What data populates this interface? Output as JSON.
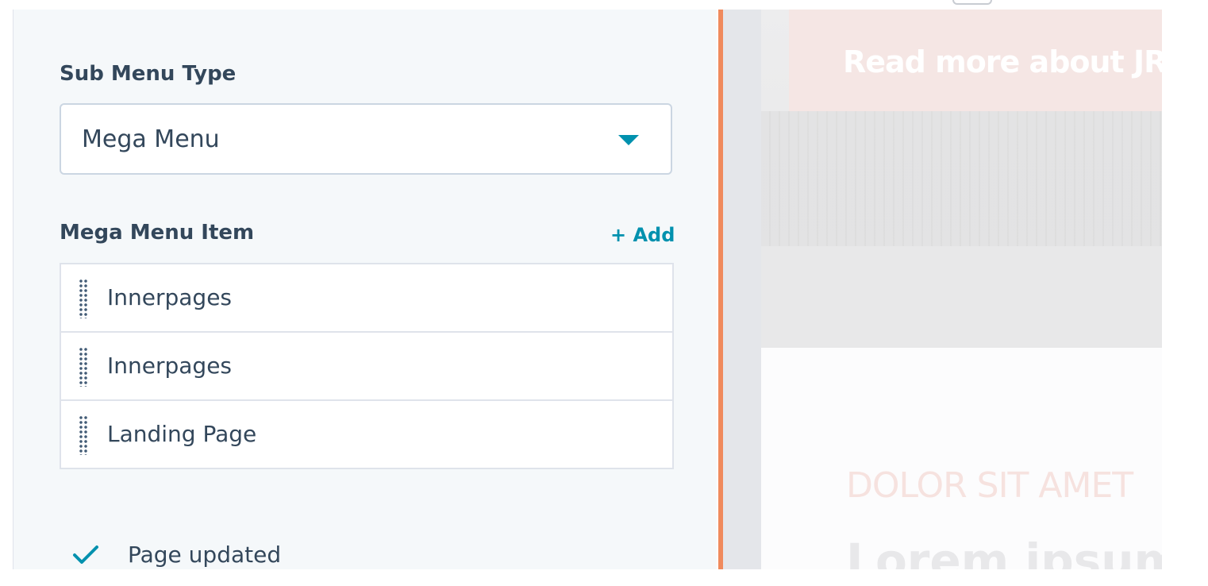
{
  "editor": {
    "sub_menu_type": {
      "label": "Sub Menu Type",
      "value": "Mega Menu"
    },
    "mega_menu_items": {
      "label": "Mega Menu Item",
      "add_label": "+ Add",
      "items": [
        {
          "label": "Innerpages"
        },
        {
          "label": "Innerpages"
        },
        {
          "label": "Landing Page"
        }
      ]
    },
    "status": {
      "text": "Page updated"
    }
  },
  "preview": {
    "banner_text": "Read more about JRC",
    "eyebrow": "DOLOR SIT AMET",
    "heading": "Lorem ipsum"
  },
  "colors": {
    "accent": "#0091ae",
    "text": "#33475b",
    "divider": "#f08a5d",
    "panel_bg": "#f5f8fa"
  }
}
